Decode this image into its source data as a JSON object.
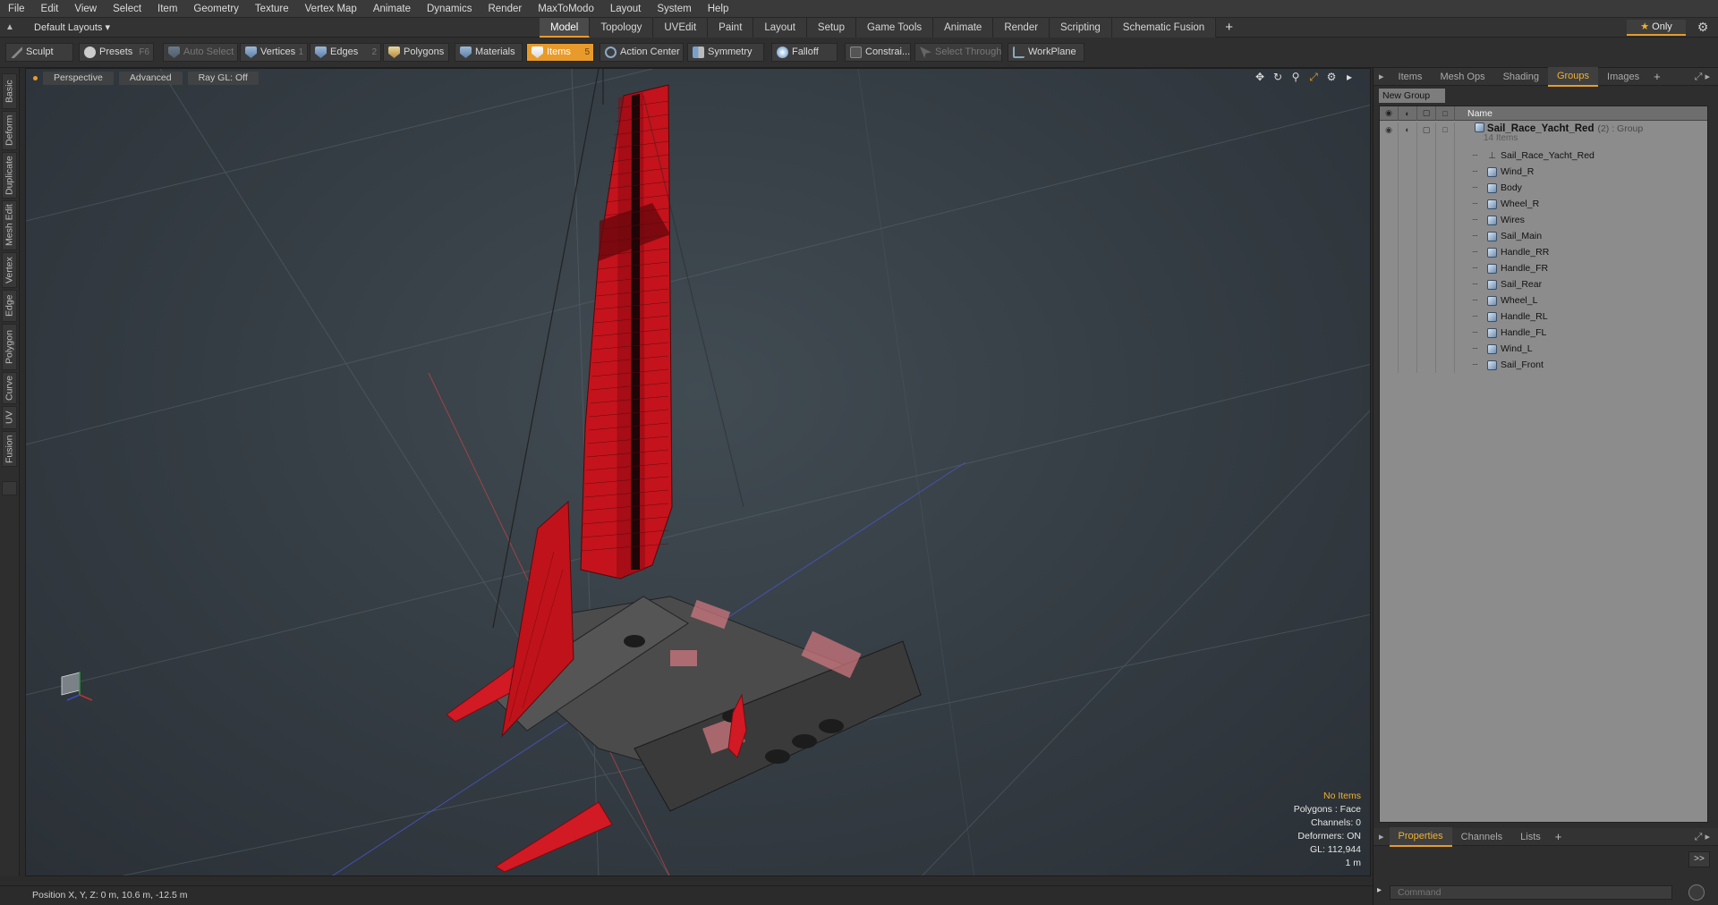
{
  "menu": [
    "File",
    "Edit",
    "View",
    "Select",
    "Item",
    "Geometry",
    "Texture",
    "Vertex Map",
    "Animate",
    "Dynamics",
    "Render",
    "MaxToModo",
    "Layout",
    "System",
    "Help"
  ],
  "layout_dropdown": "Default Layouts ▾",
  "layout_tabs": [
    {
      "label": "Model",
      "active": true
    },
    {
      "label": "Topology",
      "active": false
    },
    {
      "label": "UVEdit",
      "active": false
    },
    {
      "label": "Paint",
      "active": false
    },
    {
      "label": "Layout",
      "active": false
    },
    {
      "label": "Setup",
      "active": false
    },
    {
      "label": "Game Tools",
      "active": false
    },
    {
      "label": "Animate",
      "active": false
    },
    {
      "label": "Render",
      "active": false
    },
    {
      "label": "Scripting",
      "active": false
    },
    {
      "label": "Schematic Fusion",
      "active": false
    }
  ],
  "only_label": "Only",
  "toolbar": {
    "sculpt": "Sculpt",
    "presets": "Presets",
    "presets_key": "F6",
    "auto_select": "Auto Select",
    "vertices": "Vertices",
    "vertices_key": "1",
    "edges": "Edges",
    "edges_key": "2",
    "polygons": "Polygons",
    "materials": "Materials",
    "items": "Items",
    "items_key": "5",
    "action_center": "Action Center",
    "symmetry": "Symmetry",
    "falloff": "Falloff",
    "constraints": "Constrai...",
    "select_through": "Select Through",
    "workplane": "WorkPlane"
  },
  "left_tabs": [
    "Basic",
    "Deform",
    "Duplicate",
    "Mesh Edit",
    "Vertex",
    "Edge",
    "Polygon",
    "Curve",
    "UV",
    "Fusion"
  ],
  "viewport": {
    "view": "Perspective",
    "shading": "Advanced",
    "raygl": "Ray GL: Off",
    "info": {
      "no_items": "No Items",
      "polygons": "Polygons : Face",
      "channels": "Channels: 0",
      "deformers": "Deformers: ON",
      "gl": "GL: 112,944",
      "scale": "1 m"
    }
  },
  "status": "Position X, Y, Z:  0 m, 10.6 m, -12.5 m",
  "right_tabs": [
    {
      "label": "Items",
      "active": false
    },
    {
      "label": "Mesh Ops",
      "active": false
    },
    {
      "label": "Shading",
      "active": false
    },
    {
      "label": "Groups",
      "active": true
    },
    {
      "label": "Images",
      "active": false
    }
  ],
  "new_group": "New Group",
  "groups_header_name": "Name",
  "group": {
    "name": "Sail_Race_Yacht_Red",
    "meta": "(2) : Group",
    "count": "14 Items"
  },
  "group_items": [
    {
      "name": "Sail_Race_Yacht_Red",
      "icon": "locator-icon"
    },
    {
      "name": "Wind_R",
      "icon": "mesh-icon"
    },
    {
      "name": "Body",
      "icon": "mesh-icon"
    },
    {
      "name": "Wheel_R",
      "icon": "mesh-icon"
    },
    {
      "name": "Wires",
      "icon": "mesh-icon"
    },
    {
      "name": "Sail_Main",
      "icon": "mesh-icon"
    },
    {
      "name": "Handle_RR",
      "icon": "mesh-icon"
    },
    {
      "name": "Handle_FR",
      "icon": "mesh-icon"
    },
    {
      "name": "Sail_Rear",
      "icon": "mesh-icon"
    },
    {
      "name": "Wheel_L",
      "icon": "mesh-icon"
    },
    {
      "name": "Handle_RL",
      "icon": "mesh-icon"
    },
    {
      "name": "Handle_FL",
      "icon": "mesh-icon"
    },
    {
      "name": "Wind_L",
      "icon": "mesh-icon"
    },
    {
      "name": "Sail_Front",
      "icon": "mesh-icon"
    }
  ],
  "lower_tabs": [
    {
      "label": "Properties",
      "active": true
    },
    {
      "label": "Channels",
      "active": false
    },
    {
      "label": "Lists",
      "active": false
    }
  ],
  "command_placeholder": "Command",
  "expand_label": ">>",
  "colors": {
    "accent": "#e89b2a",
    "sail_red": "#c0121a"
  }
}
